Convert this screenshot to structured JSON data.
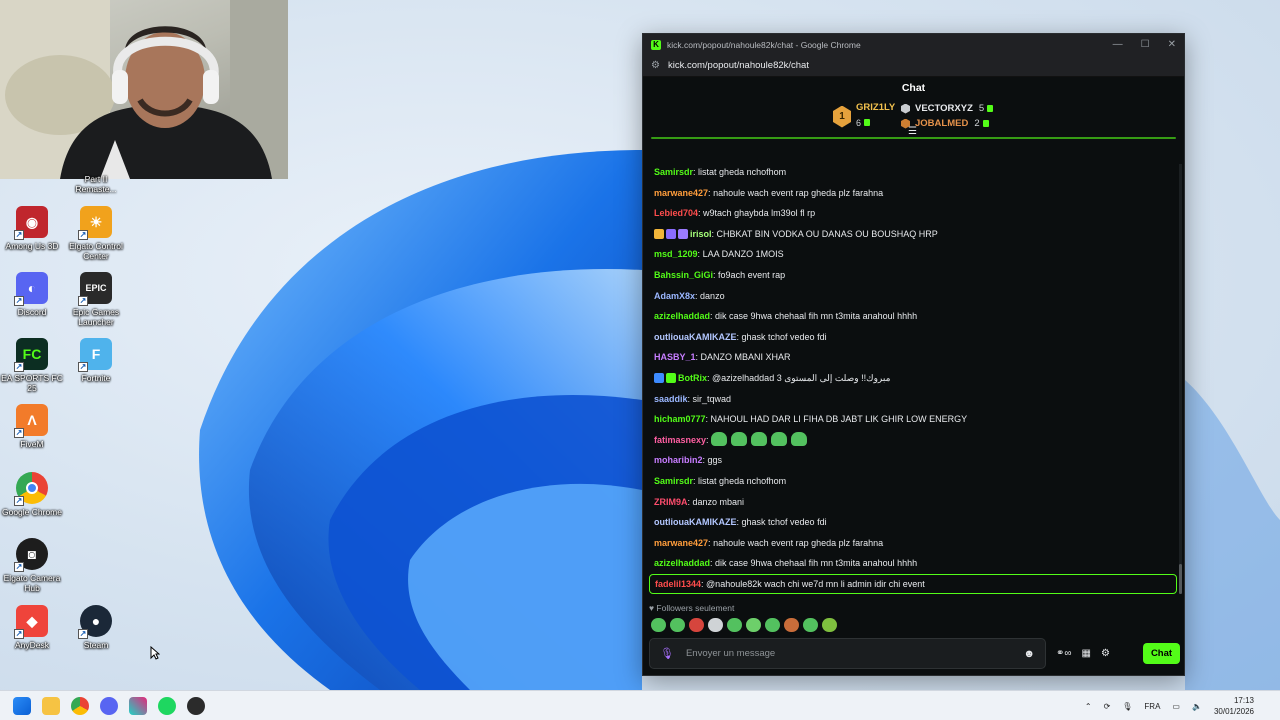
{
  "desktop": {
    "icons": [
      {
        "label": "Among Us 3D",
        "color": "#c0262d",
        "glyph": "◉"
      },
      {
        "label": "Elgato Control Center",
        "color": "#f1a21c",
        "glyph": "☀"
      },
      {
        "label": "Discord",
        "color": "#5865f2",
        "glyph": "◐"
      },
      {
        "label": "Epic Games Launcher",
        "color": "#2a2a2a",
        "glyph": "EPIC"
      },
      {
        "label": "EA SPORTS FC 25",
        "color": "#0c2e22",
        "glyph": "FC"
      },
      {
        "label": "Fortnite",
        "color": "#4fb3ec",
        "glyph": "F"
      },
      {
        "label": "FiveM",
        "color": "#f27b2a",
        "glyph": "Λ"
      },
      {
        "label": "Google Chrome",
        "color": "#ffffff",
        "glyph": "◎"
      },
      {
        "label": "Elgato Camera Hub",
        "color": "#1d1d1d",
        "glyph": "◙"
      },
      {
        "label": "AnyDesk",
        "color": "#ef443b",
        "glyph": "◆"
      },
      {
        "label": "Steam",
        "color": "#1b2838",
        "glyph": "●"
      }
    ],
    "top_labels": [
      "",
      "Part II Remaste..."
    ]
  },
  "window": {
    "title": "kick.com/popout/nahoule82k/chat - Google Chrome",
    "url": "kick.com/popout/nahoule82k/chat",
    "kick_letter": "K"
  },
  "chat": {
    "header": "Chat",
    "leaderboard": {
      "first": {
        "rank": "1",
        "name": "GRIZ1LY",
        "count": "6"
      },
      "second": {
        "name": "VECTORXYZ",
        "count": "5"
      },
      "third": {
        "name": "JOBALMED",
        "count": "2"
      }
    },
    "messages": [
      {
        "user": "Samirsdr",
        "color": "#53fc18",
        "text": "listat gheda nchofhom"
      },
      {
        "user": "marwane427",
        "color": "#ff9d3c",
        "text": "nahoule wach event rap gheda plz farahna"
      },
      {
        "user": "Lebied704",
        "color": "#ff4d4d",
        "text": "w9tach ghaybda lm39ol fl rp"
      },
      {
        "user": "irisol",
        "color": "#a6ff7a",
        "text": "CHBKAT BIN VODKA OU DANAS OU BOUSHAQ HRP",
        "badges": [
          "#f2b63a",
          "#8a6cff",
          "#9b7bff"
        ]
      },
      {
        "user": "msd_1209",
        "color": "#53fc18",
        "text": "LAA DANZO 1MOIS"
      },
      {
        "user": "Bahssin_GiGi",
        "color": "#53fc18",
        "text": "fo9ach event rap"
      },
      {
        "user": "AdamX8x",
        "color": "#9bb7ff",
        "text": "danzo"
      },
      {
        "user": "azizelhaddad",
        "color": "#53fc18",
        "text": "dik case 9hwa chehaal fih mn t3mita anahoul hhhh"
      },
      {
        "user": "outliouaKAMIKAZE",
        "color": "#b3c7ff",
        "text": "ghask tchof vedeo fdi"
      },
      {
        "user": "HASBY_1",
        "color": "#c77dff",
        "text": "DANZO MBANI XHAR"
      },
      {
        "user": "BotRix",
        "color": "#53fc18",
        "text": "@azizelhaddad مبروك!! وصلت إلى المستوى 3",
        "badges": [
          "#3d8bff",
          "#53fc18"
        ]
      },
      {
        "user": "saaddik",
        "color": "#9bb7ff",
        "text": "sir_tqwad"
      },
      {
        "user": "hicham0777",
        "color": "#53fc18",
        "text": "NAHOUL HAD DAR LI FIHA DB JABT LIK GHIR LOW ENERGY"
      },
      {
        "user": "fatimasnexy",
        "color": "#ff5fa2",
        "text": "",
        "emotes": 5
      },
      {
        "user": "moharibin2",
        "color": "#c77dff",
        "text": "ggs"
      },
      {
        "user": "Samirsdr",
        "color": "#53fc18",
        "text": "listat gheda nchofhom"
      },
      {
        "user": "ZRIM9A",
        "color": "#ff4d6d",
        "text": "danzo mbani"
      },
      {
        "user": "outliouaKAMIKAZE",
        "color": "#b3c7ff",
        "text": "ghask tchof vedeo fdi"
      },
      {
        "user": "marwane427",
        "color": "#ff9d3c",
        "text": "nahoule wach event rap gheda plz farahna"
      },
      {
        "user": "azizelhaddad",
        "color": "#53fc18",
        "text": "dik case 9hwa chehaal fih mn t3mita anahoul hhhh"
      },
      {
        "user": "fadelil1344",
        "color": "#ff4d4d",
        "text": "@nahoule82k wach chi we7d mn li admin idir chi event",
        "highlighted": true
      }
    ],
    "followers_only": "Followers seulement",
    "input_placeholder": "Envoyer un message",
    "send_label": "Chat"
  },
  "taskbar": {
    "language": "FRA",
    "time": "17:13",
    "date": "30/01/2026",
    "apps": [
      "windows-start",
      "file-explorer",
      "chrome",
      "discord",
      "capcut",
      "spotify",
      "obs"
    ]
  },
  "colors": {
    "accent": "#53fc18",
    "chat_bg": "#0b0e0f"
  }
}
